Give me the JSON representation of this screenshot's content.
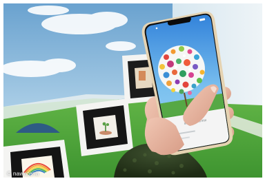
{
  "photo_credit": "© nawatena",
  "phone": {
    "status_time": "",
    "caption": "IIIIIIIII IIIIIIIIIII IIIIII"
  },
  "colors": {
    "sky_wall": "#7fb2d8",
    "turf": "#4fa83b",
    "frame_white": "#f4f4f2",
    "phone_gold": "#e5d3b2",
    "sweater": "#2a3a1e"
  }
}
